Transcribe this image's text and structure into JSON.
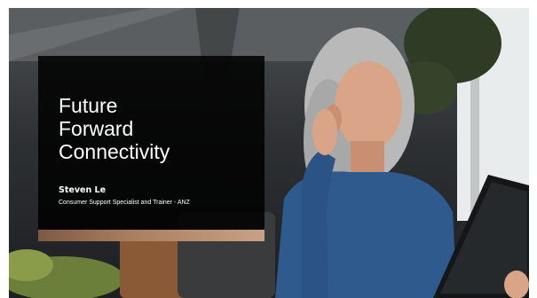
{
  "slide": {
    "title": "Future\nForward\nConnectivity",
    "presenter_name": "Steven Le",
    "presenter_role": "Consumer Support Specialist and Trainer - ANZ"
  },
  "background_photo": {
    "subject": "woman-holding-tablet-touching-ear"
  },
  "colors": {
    "panel": "#000000",
    "accent_bar": "#a97e5e",
    "sweater": "#2f5a8e",
    "hair": "#c9c9c9"
  }
}
